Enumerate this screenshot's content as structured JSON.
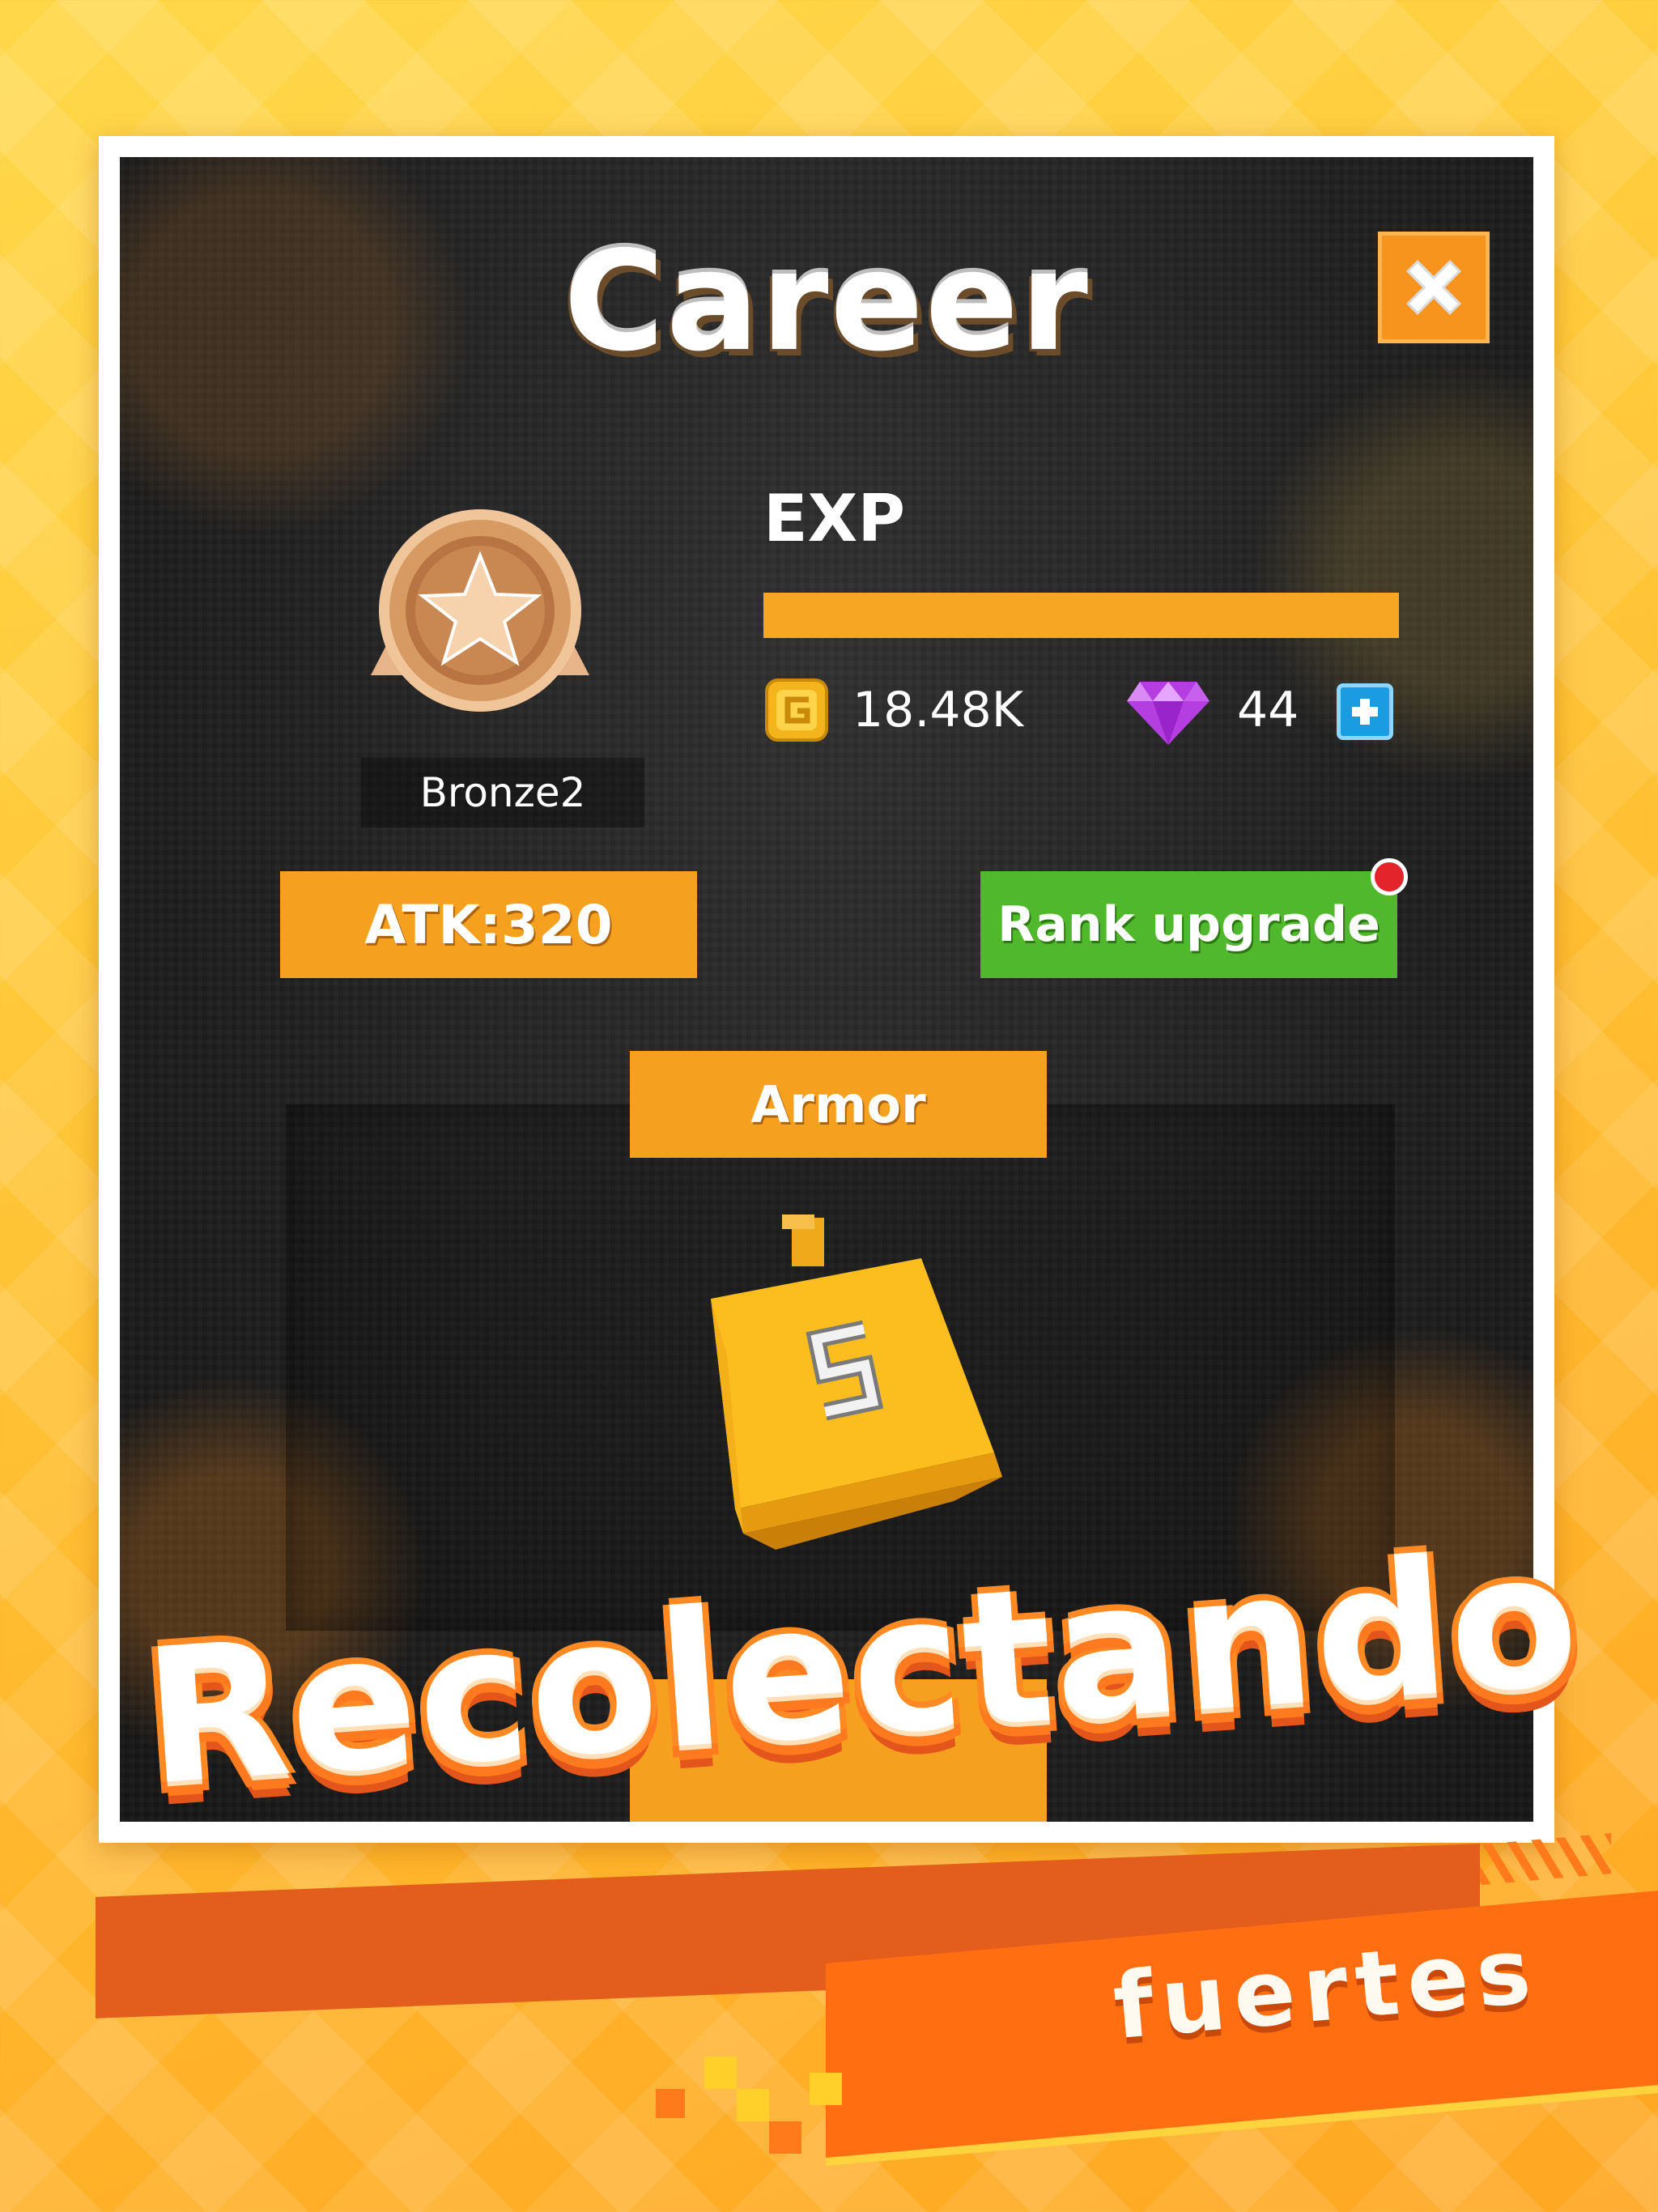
{
  "popup": {
    "title": "Career",
    "close_icon": "close-icon",
    "rank": {
      "badge_icon": "bronze-star-badge-icon",
      "name": "Bronze2"
    },
    "exp": {
      "label": "EXP",
      "progress": 1.0
    },
    "currency": {
      "coins_icon": "gold-coin-icon",
      "coins": "18.48K",
      "gems_icon": "purple-gem-icon",
      "gems": "44",
      "add_icon": "plus-icon"
    },
    "buttons": {
      "attack": "ATK:320",
      "rank_upgrade": "Rank upgrade",
      "armor": "Armor"
    },
    "armor_item": {
      "icon": "armor-tank-icon",
      "level": "5"
    }
  },
  "promo": {
    "headline": "Recolectando",
    "subline": "fuertes"
  },
  "colors": {
    "accent_orange": "#f6a020",
    "green": "#4fb82c",
    "notification_red": "#e4242b",
    "background_yellow": "#ffc93a"
  }
}
